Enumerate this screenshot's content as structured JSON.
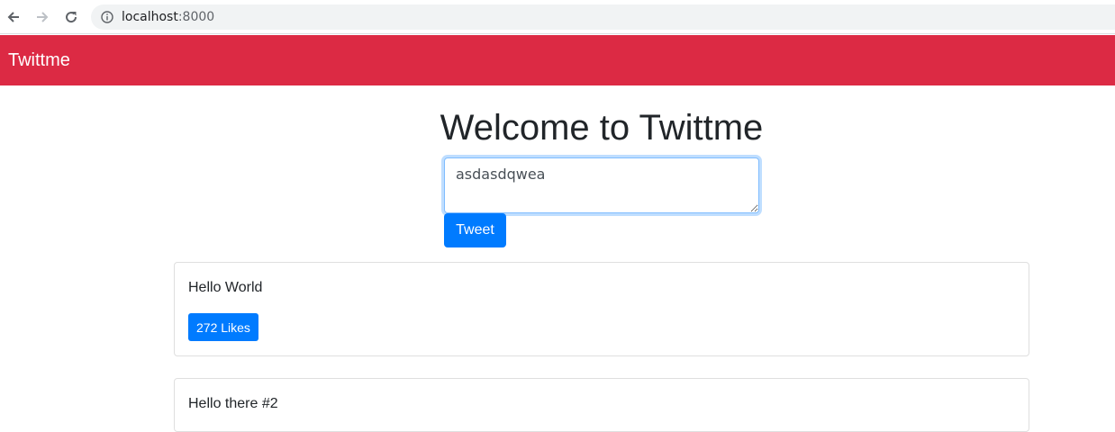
{
  "browser": {
    "url_host": "localhost",
    "url_port": ":8000"
  },
  "navbar": {
    "brand": "Twittme"
  },
  "main": {
    "heading": "Welcome to Twittme",
    "tweet_input_value": "asdasdqwea",
    "tweet_button_label": "Tweet"
  },
  "tweets": [
    {
      "content": "Hello World",
      "likes_label": "272 Likes"
    },
    {
      "content": "Hello there #2"
    }
  ],
  "colors": {
    "navbar_bg": "#dc2a44",
    "primary": "#007bff"
  }
}
